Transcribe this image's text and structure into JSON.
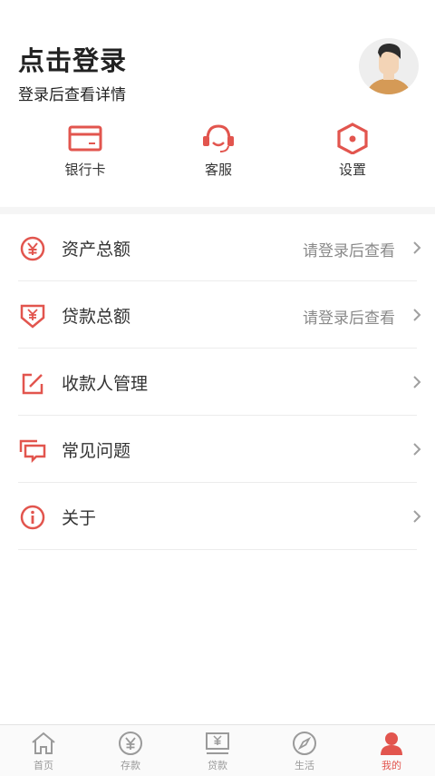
{
  "header": {
    "title": "点击登录",
    "subtitle": "登录后查看详情"
  },
  "quick_actions": [
    {
      "label": "银行卡",
      "icon": "bank-card-icon"
    },
    {
      "label": "客服",
      "icon": "headset-icon"
    },
    {
      "label": "设置",
      "icon": "settings-hexagon-icon"
    }
  ],
  "menu": [
    {
      "label": "资产总额",
      "hint": "请登录后查看",
      "icon": "yuan-circle-icon"
    },
    {
      "label": "贷款总额",
      "hint": "请登录后查看",
      "icon": "yuan-down-icon"
    },
    {
      "label": "收款人管理",
      "hint": "",
      "icon": "edit-square-icon"
    },
    {
      "label": "常见问题",
      "hint": "",
      "icon": "chat-bubbles-icon"
    },
    {
      "label": "关于",
      "hint": "",
      "icon": "info-circle-icon"
    }
  ],
  "tabs": [
    {
      "label": "首页",
      "icon": "home-icon",
      "active": false
    },
    {
      "label": "存款",
      "icon": "yuan-circle-icon",
      "active": false
    },
    {
      "label": "贷款",
      "icon": "loan-screen-icon",
      "active": false
    },
    {
      "label": "生活",
      "icon": "compass-icon",
      "active": false
    },
    {
      "label": "我的",
      "icon": "user-icon",
      "active": true
    }
  ],
  "colors": {
    "accent": "#e2554e",
    "tab_inactive": "#9a9a9a",
    "hint_text": "#8a8a8a"
  }
}
